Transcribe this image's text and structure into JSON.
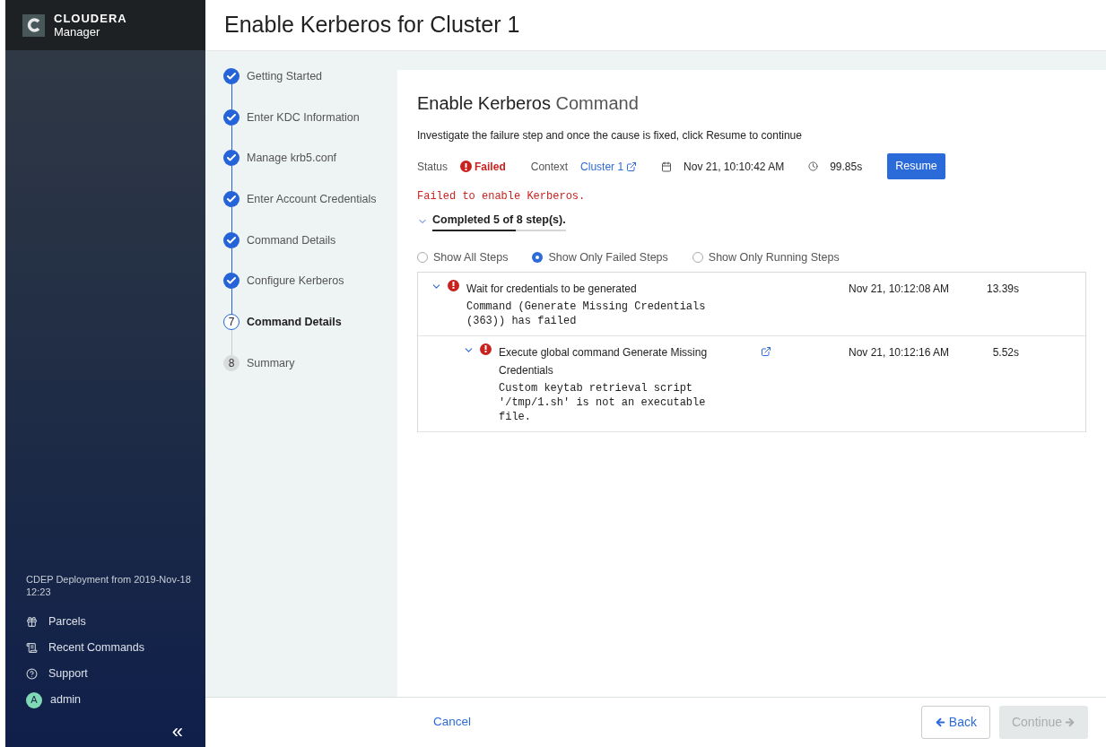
{
  "brand": {
    "name": "CLOUDERA",
    "product": "Manager"
  },
  "sidebar": {
    "deployment": "CDEP Deployment from 2019-Nov-18 12:23",
    "items": [
      {
        "kind": "parcels",
        "label": "Parcels"
      },
      {
        "kind": "commands",
        "label": "Recent Commands"
      },
      {
        "kind": "support",
        "label": "Support"
      }
    ],
    "user": {
      "initial": "A",
      "name": "admin"
    },
    "collapse": "«"
  },
  "page_title": "Enable Kerberos for Cluster 1",
  "wizard_steps": [
    {
      "label": "Getting Started",
      "done": true,
      "selected": false
    },
    {
      "label": "Enter KDC Information",
      "done": true,
      "selected": false
    },
    {
      "label": "Manage krb5.conf",
      "done": true,
      "selected": false
    },
    {
      "label": "Enter Account Credentials",
      "done": true,
      "selected": false
    },
    {
      "label": "Command Details",
      "done": true,
      "selected": false
    },
    {
      "label": "Configure Kerberos",
      "done": true,
      "selected": false
    },
    {
      "label": "Command Details",
      "done": false,
      "selected": true,
      "number": "7"
    },
    {
      "label": "Summary",
      "done": false,
      "selected": false,
      "number": "8"
    }
  ],
  "command": {
    "title": "Enable Kerberos",
    "title_suffix": "Command",
    "instruction": "Investigate the failure step and once the cause is fixed, click Resume to continue",
    "status_label": "Status",
    "status": "Failed",
    "context_label": "Context",
    "context": "Cluster 1",
    "started": "Nov 21, 10:10:42 AM",
    "duration": "99.85s",
    "resume": "Resume",
    "error": "Failed to enable Kerberos.",
    "progress": {
      "label": "Completed 5 of 8 step(s).",
      "level": 0.625,
      "expanded": true
    },
    "filters": [
      {
        "label": "Show All Steps",
        "selected": false
      },
      {
        "label": "Show Only Failed Steps",
        "selected": true
      },
      {
        "label": "Show Only Running Steps",
        "selected": false
      }
    ],
    "steps": [
      {
        "title": "Wait for credentials to be generated",
        "message": "Command (Generate Missing Credentials (363)) has failed",
        "time": "Nov 21, 10:12:08 AM",
        "duration": "13.39s",
        "failed": true,
        "expanded": true,
        "children": [
          {
            "title": "Execute global command Generate Missing Credentials",
            "message": "Custom keytab retrieval script '/tmp/1.sh' is not an executable file.",
            "time": "Nov 21, 10:12:16 AM",
            "duration": "5.52s",
            "failed": true,
            "expanded": true,
            "link": true
          }
        ]
      }
    ]
  },
  "footer": {
    "cancel": "Cancel",
    "back": "Back",
    "continue": "Continue",
    "continue_disabled": true
  }
}
